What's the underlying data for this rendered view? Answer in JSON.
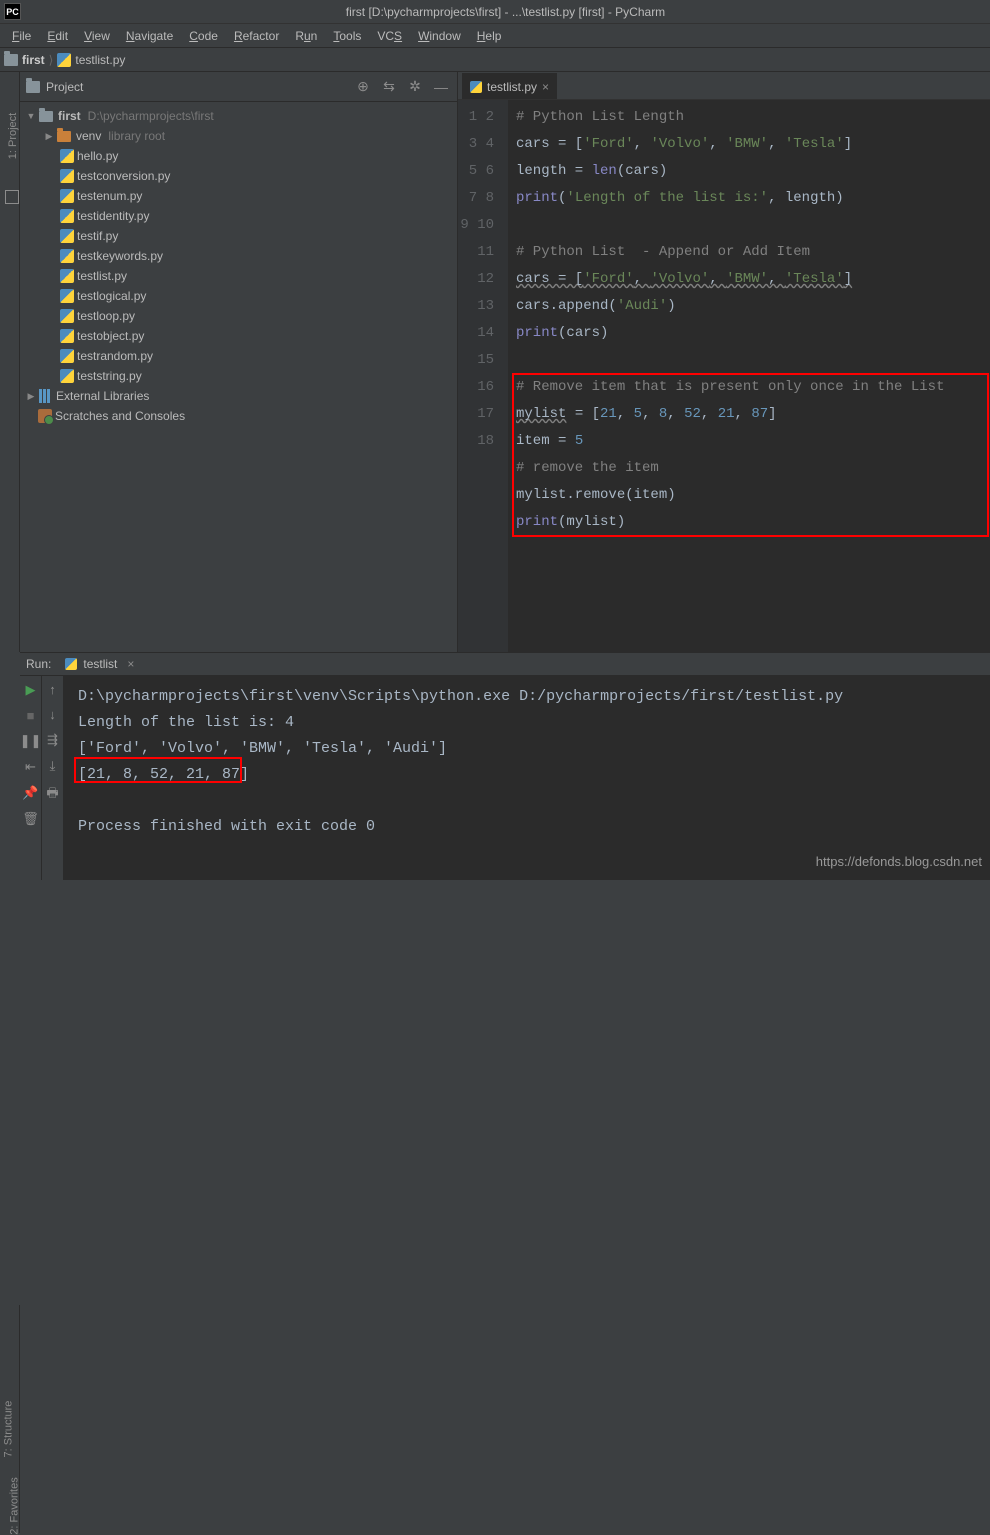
{
  "window_title": "first [D:\\pycharmprojects\\first] - ...\\testlist.py [first] - PyCharm",
  "menu": [
    "File",
    "Edit",
    "View",
    "Navigate",
    "Code",
    "Refactor",
    "Run",
    "Tools",
    "VCS",
    "Window",
    "Help"
  ],
  "breadcrumb": {
    "folder": "first",
    "file": "testlist.py"
  },
  "project_panel_label": "Project",
  "tree": {
    "root": "first",
    "root_path": "D:\\pycharmprojects\\first",
    "venv": "venv",
    "venv_hint": "library root",
    "files": [
      "hello.py",
      "testconversion.py",
      "testenum.py",
      "testidentity.py",
      "testif.py",
      "testkeywords.py",
      "testlist.py",
      "testlogical.py",
      "testloop.py",
      "testobject.py",
      "testrandom.py",
      "teststring.py"
    ],
    "ext_lib": "External Libraries",
    "scratch": "Scratches and Consoles"
  },
  "tab_label": "testlist.py",
  "code_lines": {
    "l1": "# Python List Length",
    "l6": "# Python List  - Append or Add Item",
    "l11": "# Remove item that is present only once in the List",
    "l14": "# remove the item"
  },
  "strings": {
    "ford": "'Ford'",
    "volvo": "'Volvo'",
    "bmw": "'BMW'",
    "tesla": "'Tesla'",
    "audi": "'Audi'",
    "len_msg": "'Length of the list is:'"
  },
  "nums": {
    "n21": "21",
    "n5": "5",
    "n8": "8",
    "n52": "52",
    "n87": "87"
  },
  "run": {
    "label": "Run:",
    "tab": "testlist",
    "out1": "D:\\pycharmprojects\\first\\venv\\Scripts\\python.exe D:/pycharmprojects/first/testlist.py",
    "out2": "Length of the list is: 4",
    "out3": "['Ford', 'Volvo', 'BMW', 'Tesla', 'Audi']",
    "out4": "[21, 8, 52, 21, 87]",
    "out5": "Process finished with exit code 0"
  },
  "watermark": "https://defonds.blog.csdn.net"
}
